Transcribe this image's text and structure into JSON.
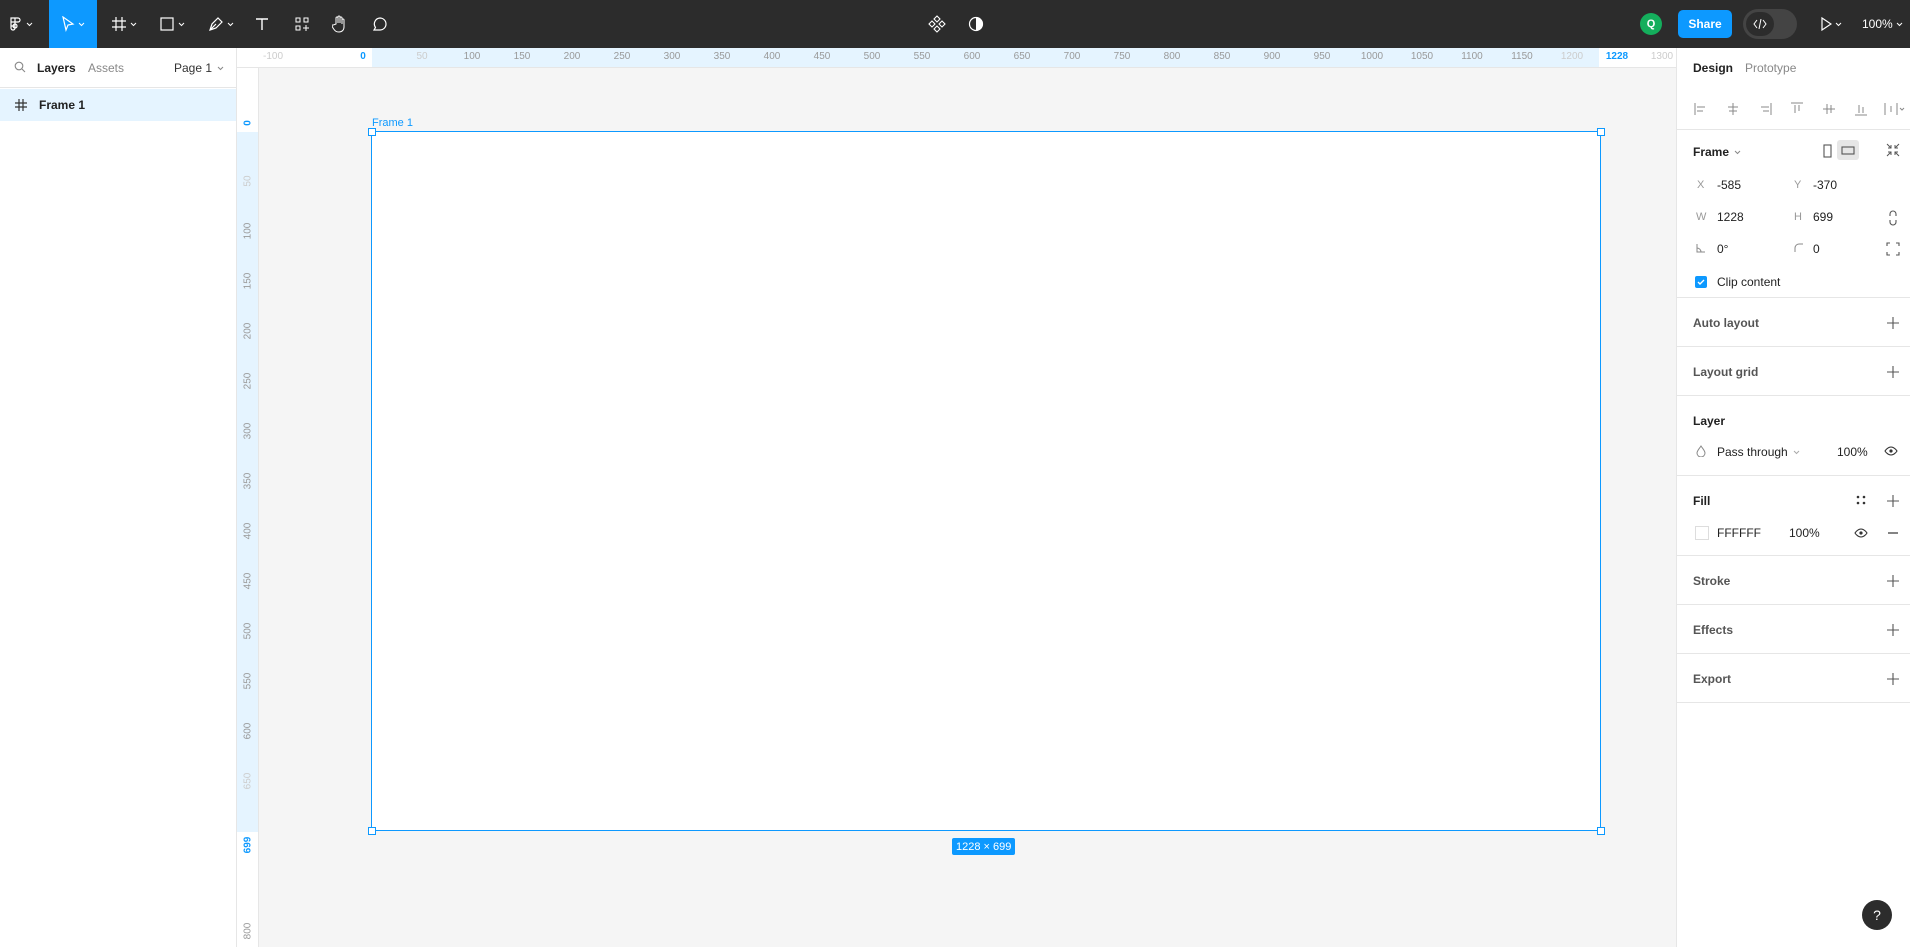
{
  "toolbar": {
    "tools": [
      {
        "name": "main-menu",
        "icon": "figma-logo-icon"
      },
      {
        "name": "move",
        "icon": "cursor-icon"
      },
      {
        "name": "frame",
        "icon": "frame-icon"
      },
      {
        "name": "shape",
        "icon": "rectangle-icon"
      },
      {
        "name": "pen",
        "icon": "pen-icon"
      },
      {
        "name": "text",
        "icon": "text-icon"
      },
      {
        "name": "resources",
        "icon": "resources-icon"
      },
      {
        "name": "hand",
        "icon": "hand-icon"
      },
      {
        "name": "comment",
        "icon": "comment-icon"
      }
    ],
    "center": [
      {
        "name": "components",
        "icon": "components-icon"
      },
      {
        "name": "theme",
        "icon": "contrast-icon"
      }
    ],
    "avatar_initial": "Q",
    "share_label": "Share",
    "zoom": "100%"
  },
  "left_panel": {
    "tabs": {
      "layers": "Layers",
      "assets": "Assets"
    },
    "page": "Page 1",
    "layers": [
      {
        "name": "Frame 1",
        "icon": "frame-hash-icon"
      }
    ]
  },
  "ruler": {
    "top": [
      "-100",
      "0",
      "50",
      "100",
      "150",
      "200",
      "250",
      "300",
      "350",
      "400",
      "450",
      "500",
      "550",
      "600",
      "650",
      "700",
      "750",
      "800",
      "850",
      "900",
      "950",
      "1000",
      "1050",
      "1100",
      "1150",
      "1200",
      "1228",
      "1300"
    ],
    "left": [
      "0",
      "50",
      "100",
      "150",
      "200",
      "250",
      "300",
      "350",
      "400",
      "450",
      "500",
      "550",
      "600",
      "650",
      "699",
      "800"
    ]
  },
  "canvas": {
    "frame_label": "Frame 1",
    "size_badge": "1228 × 699"
  },
  "right_panel": {
    "tabs": {
      "design": "Design",
      "prototype": "Prototype"
    },
    "frame": {
      "title": "Frame",
      "x_label": "X",
      "x": "-585",
      "y_label": "Y",
      "y": "-370",
      "w_label": "W",
      "w": "1228",
      "h_label": "H",
      "h": "699",
      "rotation": "0°",
      "radius": "0",
      "clip_content": "Clip content"
    },
    "auto_layout": "Auto layout",
    "layout_grid": "Layout grid",
    "layer": {
      "title": "Layer",
      "blend": "Pass through",
      "opacity": "100%"
    },
    "fill": {
      "title": "Fill",
      "color": "FFFFFF",
      "opacity": "100%"
    },
    "stroke": "Stroke",
    "effects": "Effects",
    "export": "Export"
  },
  "help": "?",
  "colors": {
    "accent": "#0d99ff",
    "toolbar_bg": "#2c2c2c",
    "avatar": "#14ae5c"
  }
}
